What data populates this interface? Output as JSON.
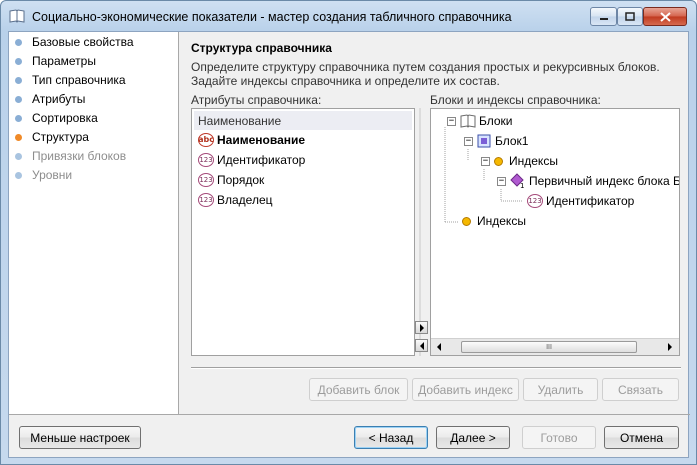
{
  "window": {
    "title": "Социально-экономические показатели - мастер создания табличного справочника",
    "icons": [
      "book-icon",
      "minimize-icon",
      "maximize-icon",
      "close-icon"
    ]
  },
  "nav": {
    "items": [
      {
        "label": "Базовые свойства",
        "state": "done"
      },
      {
        "label": "Параметры",
        "state": "done"
      },
      {
        "label": "Тип справочника",
        "state": "done"
      },
      {
        "label": "Атрибуты",
        "state": "done"
      },
      {
        "label": "Сортировка",
        "state": "done"
      },
      {
        "label": "Структура",
        "state": "current"
      },
      {
        "label": "Привязки блоков",
        "state": "disabled"
      },
      {
        "label": "Уровни",
        "state": "disabled"
      }
    ]
  },
  "main": {
    "heading": "Структура справочника",
    "description": "Определите структуру справочника путем создания простых и рекурсивных блоков. Задайте индексы справочника и определите их состав.",
    "attributes_label": "Атрибуты справочника:",
    "blocks_label": "Блоки и индексы справочника:",
    "attributes": [
      {
        "label": "Наименование",
        "icon": "",
        "selected": true
      },
      {
        "label": "Наименование",
        "icon": "abc-icon",
        "bold": true
      },
      {
        "label": "Идентификатор",
        "icon": "123-icon"
      },
      {
        "label": "Порядок",
        "icon": "123-icon"
      },
      {
        "label": "Владелец",
        "icon": "123-icon"
      }
    ],
    "tree": {
      "root": "Блоки",
      "block": "Блок1",
      "indexes": "Индексы",
      "primary_index": "Первичный индекс блока Бло",
      "field": "Идентификатор",
      "root_indexes": "Индексы"
    },
    "scroll_grip": "III",
    "actions": {
      "add_block": "Добавить блок",
      "add_index": "Добавить индекс",
      "delete": "Удалить",
      "link": "Связать"
    }
  },
  "footer": {
    "less_settings": "Меньше настроек",
    "back": "< Назад",
    "next": "Далее >",
    "finish": "Готово",
    "cancel": "Отмена"
  }
}
